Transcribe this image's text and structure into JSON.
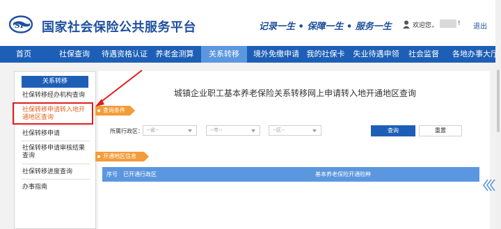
{
  "header": {
    "title": "国家社会保险公共服务平台",
    "slogan": "记录一生 • 保障一生 • 服务一生",
    "welcome": "欢迎您，",
    "welcome_suffix": "!",
    "logout": "退出"
  },
  "nav": {
    "items": [
      {
        "label": "首页"
      },
      {
        "label": "社保查询"
      },
      {
        "label": "待遇资格认证"
      },
      {
        "label": "养老金测算"
      },
      {
        "label": "关系转移"
      },
      {
        "label": "境外免缴申请"
      },
      {
        "label": "我的社保卡"
      },
      {
        "label": "失业待遇申领"
      },
      {
        "label": "社会监督"
      },
      {
        "label": "各地办事大厅"
      }
    ],
    "active": "关系转移"
  },
  "sidebar": {
    "title": "关系转移",
    "items": [
      {
        "label": "社保转移经办机构查询"
      },
      {
        "label": "社保转移申请转入地开通地区查询"
      },
      {
        "label": "社保转移申请"
      },
      {
        "label": "社保转移申请审核结果查询"
      },
      {
        "label": "社保转移进度查询"
      },
      {
        "label": "办事指南"
      }
    ]
  },
  "content": {
    "title": "城镇企业职工基本养老保险关系转移网上申请转入地开通地区查询",
    "query_section": "查询条件",
    "field_label": "所属行政区：",
    "province_placeholder": "--省--",
    "city_placeholder": "--市--",
    "district_placeholder": "--区--",
    "query_button": "查询",
    "reset_button": "重置",
    "info_section": "开通地区信息",
    "table_columns": [
      "序号",
      "已开通行政区",
      "基本养老保险开通险种"
    ]
  },
  "colors": {
    "brand_blue": "#1d5fb6",
    "nav_active": "#5b97df",
    "accent_orange": "#f39c3a",
    "highlight_red": "#e11d1d"
  }
}
